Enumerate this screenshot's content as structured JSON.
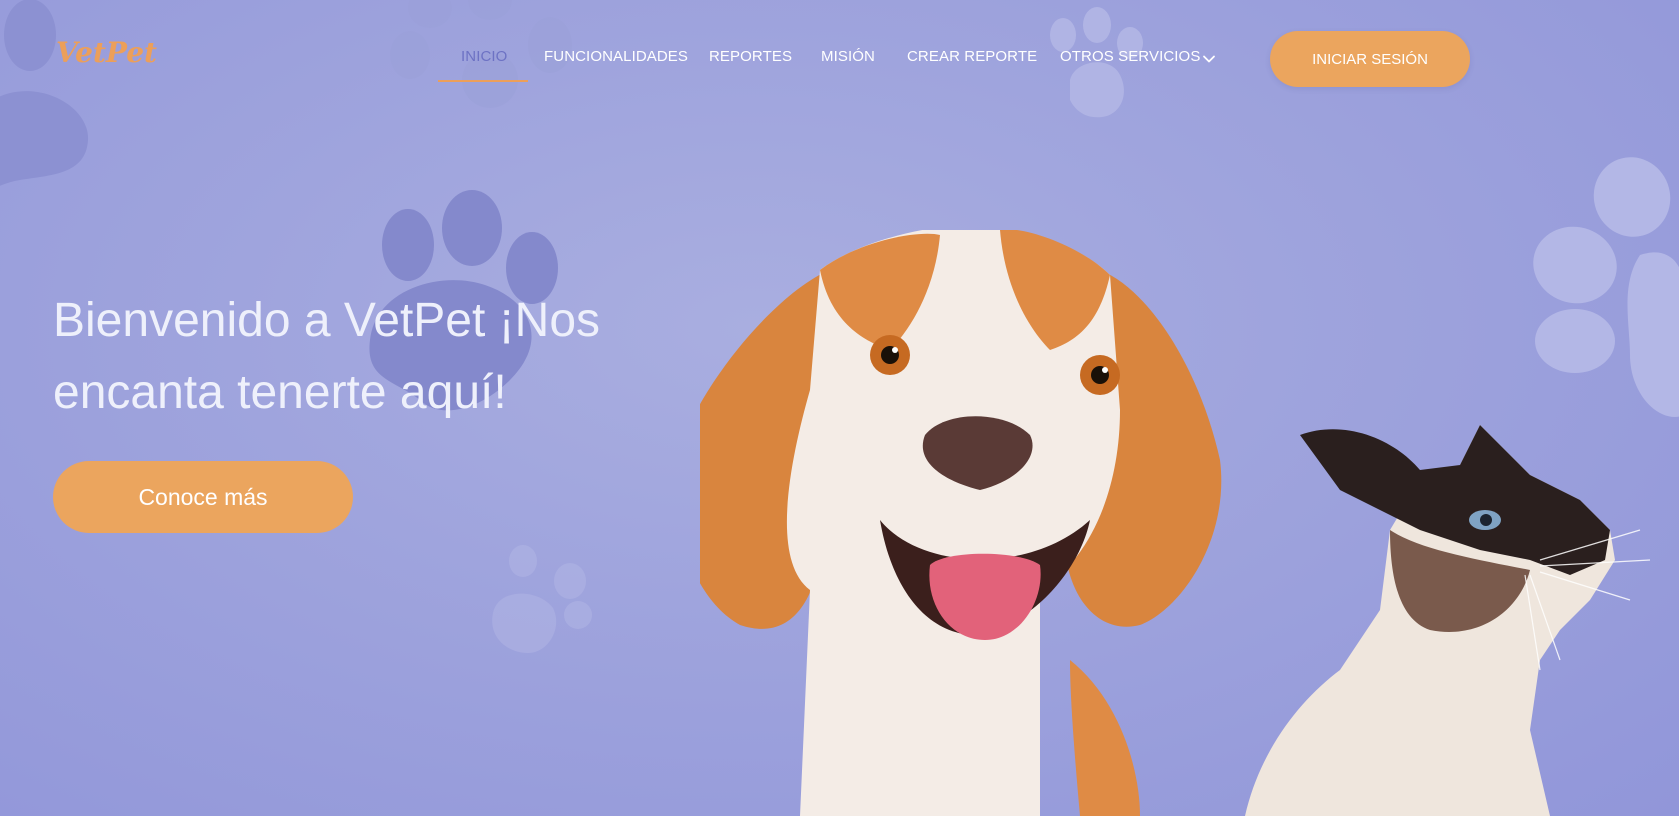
{
  "brand": {
    "logo_text": "VetPet",
    "logo_color": "#ec9f5a"
  },
  "nav": {
    "items": [
      {
        "label": "INICIO",
        "active": true
      },
      {
        "label": "FUNCIONALIDADES",
        "active": false
      },
      {
        "label": "REPORTES",
        "active": false
      },
      {
        "label": "MISIÓN",
        "active": false
      },
      {
        "label": "CREAR REPORTE",
        "active": false
      },
      {
        "label": "OTROS SERVICIOS",
        "active": false,
        "dropdown": true
      }
    ],
    "login_label": "INICIAR SESIÓN"
  },
  "hero": {
    "title": "Bienvenido a VetPet ¡Nos encanta tenerte aquí!",
    "cta_label": "Conoce más"
  },
  "icons": {
    "dropdown": "chevron-down-icon",
    "decor": "paw-print-icon"
  },
  "colors": {
    "background": "#9fa4dd",
    "accent": "#eba55e",
    "active_nav": "#6d72c4",
    "paw_dark": "#7d82c8",
    "paw_light": "#b5b9e6"
  }
}
